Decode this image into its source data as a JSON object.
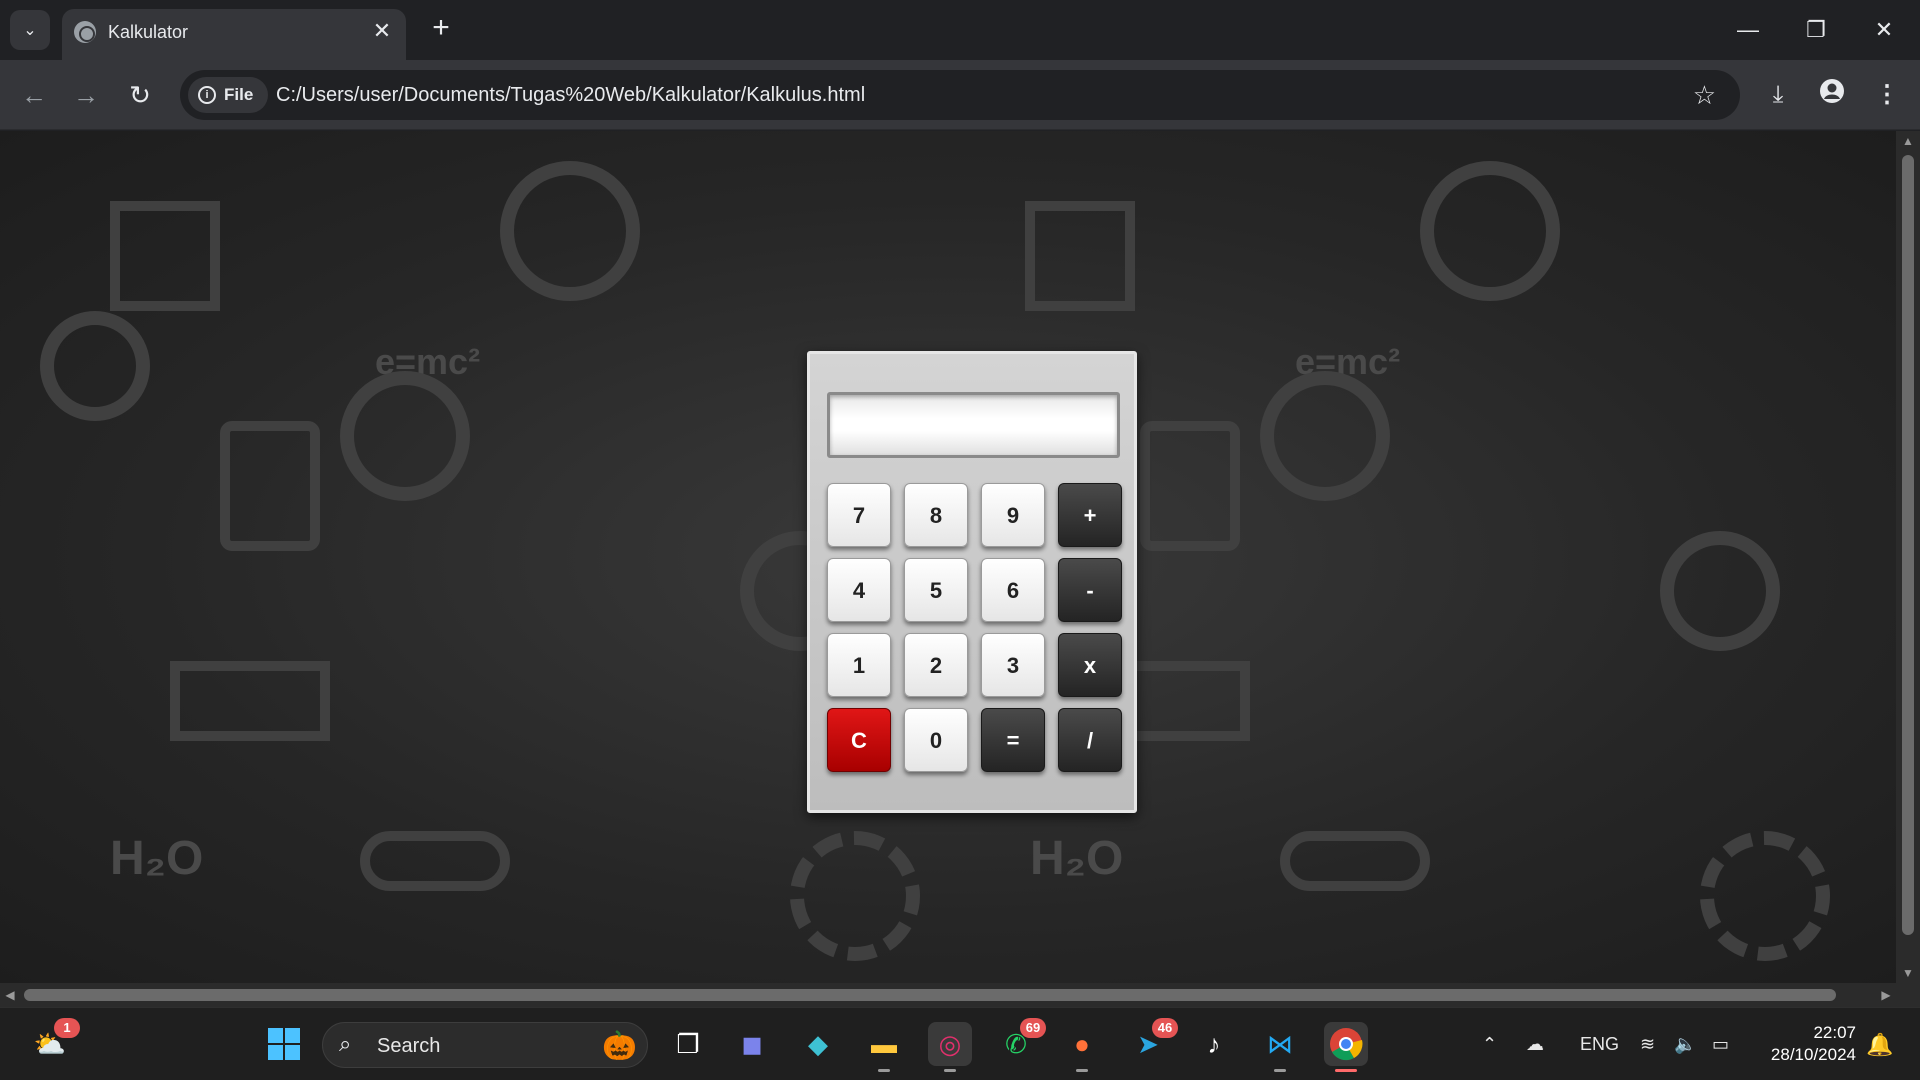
{
  "browser": {
    "tab_title": "Kalkulator",
    "tab_close": "✕",
    "new_tab": "+",
    "site_chip": "File",
    "url": "C:/Users/user/Documents/Tugas%20Web/Kalkulator/Kalkulus.html",
    "window_controls": {
      "minimize": "—",
      "maximize": "❐",
      "close": "✕"
    }
  },
  "calculator": {
    "display_value": "",
    "keys": [
      {
        "label": "7",
        "kind": "num"
      },
      {
        "label": "8",
        "kind": "num"
      },
      {
        "label": "9",
        "kind": "num"
      },
      {
        "label": "+",
        "kind": "op"
      },
      {
        "label": "4",
        "kind": "num"
      },
      {
        "label": "5",
        "kind": "num"
      },
      {
        "label": "6",
        "kind": "num"
      },
      {
        "label": "-",
        "kind": "op"
      },
      {
        "label": "1",
        "kind": "num"
      },
      {
        "label": "2",
        "kind": "num"
      },
      {
        "label": "3",
        "kind": "num"
      },
      {
        "label": "x",
        "kind": "op"
      },
      {
        "label": "C",
        "kind": "clear"
      },
      {
        "label": "0",
        "kind": "num"
      },
      {
        "label": "=",
        "kind": "op"
      },
      {
        "label": "/",
        "kind": "op"
      }
    ]
  },
  "background_text": {
    "formula_left": "e=mc²",
    "formula_right": "e=mc²",
    "water_left": "H₂O",
    "water_right": "H₂O"
  },
  "taskbar": {
    "search_placeholder": "Search",
    "weather_badge": "1",
    "whatsapp_badge": "69",
    "telegram_badge": "46",
    "language": "ENG",
    "time": "22:07",
    "date": "28/10/2024"
  },
  "colors": {
    "clear_key": "#c00000",
    "operator_key": "#2a2a2a",
    "number_key": "#f0f0f0",
    "calculator_body": "#c8c8c8"
  }
}
